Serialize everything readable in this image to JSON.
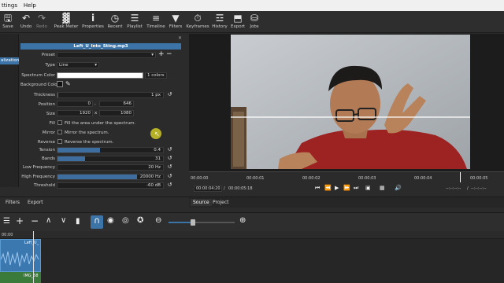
{
  "menu": {
    "items": [
      "ttings",
      "Help"
    ]
  },
  "toolbar": {
    "buttons": [
      {
        "label": "Save",
        "icon": "save-icon"
      },
      {
        "label": "Undo",
        "icon": "undo-icon"
      },
      {
        "label": "Redo",
        "icon": "redo-icon"
      },
      {
        "label": "Peak Meter",
        "icon": "peak-meter-icon"
      },
      {
        "label": "Properties",
        "icon": "properties-icon"
      },
      {
        "label": "Recent",
        "icon": "recent-icon"
      },
      {
        "label": "Playlist",
        "icon": "playlist-icon"
      },
      {
        "label": "Timeline",
        "icon": "timeline-icon"
      },
      {
        "label": "Filters",
        "icon": "filters-icon"
      },
      {
        "label": "Keyframes",
        "icon": "keyframes-icon"
      },
      {
        "label": "History",
        "icon": "history-icon"
      },
      {
        "label": "Export",
        "icon": "export-icon"
      },
      {
        "label": "Jobs",
        "icon": "jobs-icon"
      }
    ]
  },
  "left_panel": {
    "selected_item": "alization",
    "filename": "Left_U_Into_Sting.mp3",
    "preset_label": "Preset",
    "type_label": "Type",
    "type_value": "Line",
    "spectrum_color_label": "Spectrum Color",
    "spectrum_color_value": "1 colors",
    "background_color_label": "Background Color",
    "thickness_label": "Thickness",
    "thickness_value": "1 px",
    "position_label": "Position",
    "position_x": "0",
    "position_sep": ",",
    "position_y": "646",
    "size_label": "Size",
    "size_w": "1920",
    "size_sep": "x",
    "size_h": "1080",
    "fill_label": "Fill",
    "fill_text": "Fill the area under the spectrum.",
    "mirror_label": "Mirror",
    "mirror_text": "Mirror the spectrum.",
    "reverse_label": "Reverse",
    "reverse_text": "Reverse the spectrum.",
    "tension_label": "Tension",
    "tension_value": "0.4",
    "tension_fill": 0.4,
    "bands_label": "Bands",
    "bands_value": "31",
    "bands_fill": 0.26,
    "low_freq_label": "Low Frequency",
    "low_freq_value": "20 Hz",
    "low_freq_fill": 0.0,
    "high_freq_label": "High Frequency",
    "high_freq_value": "20000 Hz",
    "high_freq_fill": 0.75,
    "threshold_label": "Threshold",
    "threshold_value": "-60 dB",
    "threshold_fill": 0.0,
    "bottom_tabs": [
      "Filters",
      "Export"
    ]
  },
  "viewer": {
    "ruler_ticks": [
      "00:00:00",
      "00:00:01",
      "00:00:02",
      "00:00:03",
      "00:00:04",
      "00:00:05"
    ],
    "current_time": "00:00:04:20",
    "total_time": "00:00:05:18",
    "in_point": "--:--:--:--",
    "out_point": "--:--:--:--",
    "tabs": [
      "Source",
      "Project"
    ]
  },
  "timeline": {
    "head_time": "00:00",
    "clip1_label": "Left_U_",
    "clip2_label": "IMG_58"
  },
  "colors": {
    "accent": "#3d74a8",
    "shirt": "#9d2222",
    "wall": "#b7bcc1"
  }
}
